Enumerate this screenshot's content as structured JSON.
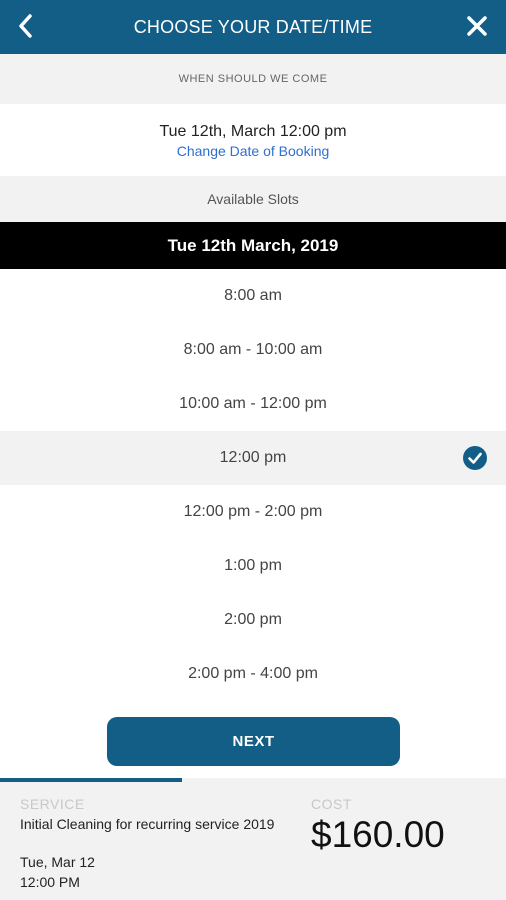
{
  "header": {
    "title": "CHOOSE YOUR DATE/TIME",
    "back_icon": "chevron-left-icon",
    "close_icon": "close-icon",
    "background": "#135e87"
  },
  "when": {
    "label": "WHEN SHOULD WE COME"
  },
  "selected": {
    "datetime": "Tue 12th, March 12:00 pm",
    "change_link": "Change Date of Booking",
    "link_color": "#2f6fd0"
  },
  "available": {
    "label": "Available Slots"
  },
  "date_header": "Tue 12th March, 2019",
  "slots": [
    {
      "label": "8:00 am",
      "selected": false
    },
    {
      "label": "8:00 am - 10:00 am",
      "selected": false
    },
    {
      "label": "10:00 am - 12:00 pm",
      "selected": false
    },
    {
      "label": "12:00 pm",
      "selected": true
    },
    {
      "label": "12:00 pm - 2:00 pm",
      "selected": false
    },
    {
      "label": "1:00 pm",
      "selected": false
    },
    {
      "label": "2:00 pm",
      "selected": false
    },
    {
      "label": "2:00 pm - 4:00 pm",
      "selected": false
    }
  ],
  "next_button": {
    "label": "NEXT"
  },
  "footer": {
    "progress": 0.36,
    "service_label": "SERVICE",
    "service_name": "Initial Cleaning for recurring service 2019",
    "service_date": "Tue, Mar 12",
    "service_time": "12:00 PM",
    "cost_label": "COST",
    "cost_value": "$160.00"
  }
}
